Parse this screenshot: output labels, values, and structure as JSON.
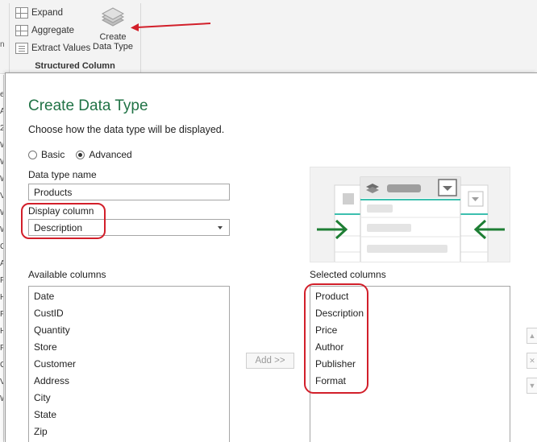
{
  "ribbon": {
    "left_fragment": "n",
    "expand_label": "Expand",
    "aggregate_label": "Aggregate",
    "extract_label": "Extract Values",
    "create_line1": "Create",
    "create_line2": "Data Type",
    "group_label": "Structured Column"
  },
  "background_strip": [
    "e",
    "A",
    "2",
    "W",
    "W",
    "W",
    "V",
    "W",
    "W",
    "C",
    "A",
    "F",
    "H",
    "P",
    "H",
    "P",
    "G",
    "V",
    "W"
  ],
  "dialog": {
    "title": "Create Data Type",
    "subtitle": "Choose how the data type will be displayed.",
    "mode_options": [
      {
        "label": "Basic",
        "selected": false
      },
      {
        "label": "Advanced",
        "selected": true
      }
    ],
    "name_label": "Data type name",
    "name_value": "Products",
    "display_label": "Display column",
    "display_value": "Description",
    "available_label": "Available columns",
    "available_columns": [
      "Date",
      "CustID",
      "Quantity",
      "Store",
      "Customer",
      "Address",
      "City",
      "State",
      "Zip"
    ],
    "add_button": "Add >>",
    "selected_label": "Selected columns",
    "selected_columns": [
      "Product",
      "Description",
      "Price",
      "Author",
      "Publisher",
      "Format"
    ],
    "side_buttons": [
      "up-icon",
      "remove-icon",
      "down-icon"
    ]
  },
  "colors": {
    "title_green": "#217346",
    "annotation_red": "#d21f2a",
    "illustration_arrow_green": "#1e7e34",
    "illustration_accent": "#3cbfae"
  }
}
